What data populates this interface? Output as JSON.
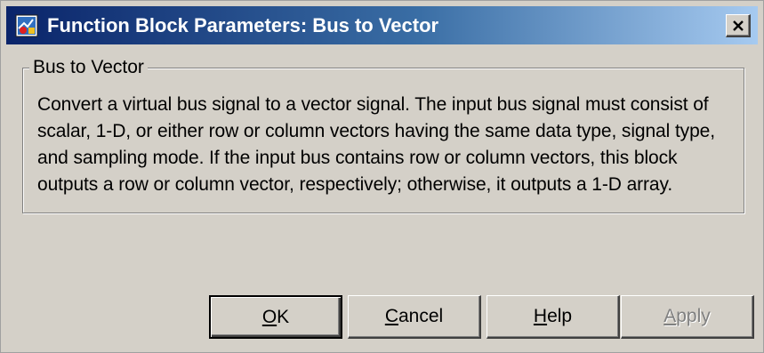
{
  "window": {
    "title": "Function Block Parameters: Bus to Vector",
    "close_label": "×"
  },
  "group": {
    "label": "Bus to Vector",
    "description_lines": [
      "Convert a virtual bus signal to a vector signal. The input bus signal must consist of",
      "scalar, 1-D, or either row or column vectors having the same data type, signal type,",
      "and sampling mode. If the input bus contains row or column vectors, this block",
      "outputs a row or column vector, respectively; otherwise, it outputs a 1-D array."
    ]
  },
  "buttons": {
    "ok": {
      "accel": "O",
      "rest": "K"
    },
    "cancel": {
      "accel": "C",
      "rest": "ancel"
    },
    "help": {
      "accel": "H",
      "rest": "elp"
    },
    "apply": {
      "accel": "A",
      "rest": "pply",
      "enabled": false
    }
  },
  "colors": {
    "title_gradient_start": "#0a246a",
    "title_gradient_end": "#a6caf0",
    "face": "#d4d0c8",
    "disabled_text": "#808080"
  },
  "icons": {
    "title": "simulink-block-icon",
    "close": "close-icon"
  }
}
